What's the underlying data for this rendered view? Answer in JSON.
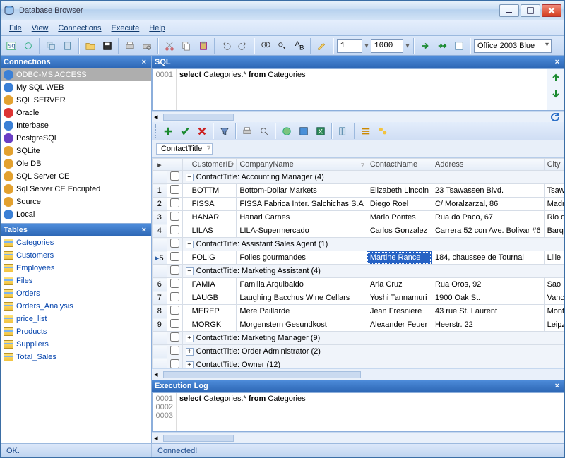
{
  "window": {
    "title": "Database Browser"
  },
  "menu": {
    "file": "File",
    "view": "View",
    "connections": "Connections",
    "execute": "Execute",
    "help": "Help"
  },
  "toolbar": {
    "page_input": "1",
    "rows_input": "1000",
    "theme": "Office 2003 Blue"
  },
  "panels": {
    "connections": "Connections",
    "tables": "Tables",
    "sql": "SQL",
    "log": "Execution Log"
  },
  "connections": [
    {
      "label": "ODBC-MS ACCESS",
      "selected": true,
      "color": "#3b80d6"
    },
    {
      "label": "My SQL WEB",
      "selected": false,
      "color": "#3b80d6"
    },
    {
      "label": "SQL SERVER",
      "selected": false,
      "color": "#e3a12f"
    },
    {
      "label": "Oracle",
      "selected": false,
      "color": "#d33"
    },
    {
      "label": "Interbase",
      "selected": false,
      "color": "#3b80d6"
    },
    {
      "label": "PostgreSQL",
      "selected": false,
      "color": "#6a3ec4"
    },
    {
      "label": "SQLite",
      "selected": false,
      "color": "#e3a12f"
    },
    {
      "label": "Ole DB",
      "selected": false,
      "color": "#e3a12f"
    },
    {
      "label": "SQL Server CE",
      "selected": false,
      "color": "#e3a12f"
    },
    {
      "label": "Sql Server CE Encripted",
      "selected": false,
      "color": "#e3a12f"
    },
    {
      "label": "Source",
      "selected": false,
      "color": "#e3a12f"
    },
    {
      "label": "Local",
      "selected": false,
      "color": "#3b80d6"
    }
  ],
  "tables": [
    "Categories",
    "Customers",
    "Employees",
    "Files",
    "Orders",
    "Orders_Analysis",
    "price_list",
    "Products",
    "Suppliers",
    "Total_Sales"
  ],
  "sql": {
    "lineno": "0001",
    "prefix": "select",
    "mid": " Categories.* ",
    "suffix": "from",
    "tail": " Categories"
  },
  "grid": {
    "group_field": "ContactTitle",
    "columns": [
      "CustomerID",
      "CompanyName",
      "ContactName",
      "Address",
      "City"
    ],
    "sortcols": [
      0,
      1
    ],
    "groups": [
      {
        "title": "ContactTitle: Accounting Manager (4)",
        "expanded": true,
        "rows": [
          {
            "n": "1",
            "CustomerID": "BOTTM",
            "CompanyName": "Bottom-Dollar Markets",
            "ContactName": "Elizabeth Lincoln",
            "Address": "23 Tsawassen Blvd.",
            "City": "Tsawassen"
          },
          {
            "n": "2",
            "CustomerID": "FISSA",
            "CompanyName": "FISSA Fabrica Inter. Salchichas S.A",
            "ContactName": "Diego Roel",
            "Address": "C/ Moralzarzal, 86",
            "City": "Madrid"
          },
          {
            "n": "3",
            "CustomerID": "HANAR",
            "CompanyName": "Hanari Carnes",
            "ContactName": "Mario Pontes",
            "Address": "Rua do Paco, 67",
            "City": "Rio de Ja"
          },
          {
            "n": "4",
            "CustomerID": "LILAS",
            "CompanyName": "LILA-Supermercado",
            "ContactName": "Carlos Gonzalez",
            "Address": "Carrera 52 con Ave. Bolivar #6",
            "City": "Barquisim"
          }
        ]
      },
      {
        "title": "ContactTitle: Assistant Sales Agent (1)",
        "expanded": true,
        "rows": [
          {
            "n": "5",
            "CustomerID": "FOLIG",
            "CompanyName": "Folies gourmandes",
            "ContactName": "Martine Rance",
            "Address": "184, chaussee de Tournai",
            "City": "Lille",
            "sel": true
          }
        ]
      },
      {
        "title": "ContactTitle: Marketing Assistant (4)",
        "expanded": true,
        "rows": [
          {
            "n": "6",
            "CustomerID": "FAMIA",
            "CompanyName": "Familia Arquibaldo",
            "ContactName": "Aria Cruz",
            "Address": "Rua Oros, 92",
            "City": "Sao Paulo"
          },
          {
            "n": "7",
            "CustomerID": "LAUGB",
            "CompanyName": "Laughing Bacchus Wine Cellars",
            "ContactName": "Yoshi Tannamuri",
            "Address": "1900 Oak St.",
            "City": "Vancouve"
          },
          {
            "n": "8",
            "CustomerID": "MEREP",
            "CompanyName": "Mere Paillarde",
            "ContactName": "Jean Fresniere",
            "Address": "43 rue St. Laurent",
            "City": "Montreal"
          },
          {
            "n": "9",
            "CustomerID": "MORGK",
            "CompanyName": "Morgenstern Gesundkost",
            "ContactName": "Alexander Feuer",
            "Address": "Heerstr. 22",
            "City": "Leipzig"
          }
        ]
      },
      {
        "title": "ContactTitle: Marketing Manager (9)",
        "expanded": false,
        "rows": []
      },
      {
        "title": "ContactTitle: Order Administrator (2)",
        "expanded": false,
        "rows": []
      },
      {
        "title": "ContactTitle: Owner (12)",
        "expanded": false,
        "rows": []
      }
    ]
  },
  "log": {
    "lines": [
      "0001",
      "0002",
      "0003"
    ],
    "prefix": "select",
    "mid": " Categories.* ",
    "suffix": "from",
    "tail": " Categories"
  },
  "status": {
    "left": "OK.",
    "right": "Connected!"
  }
}
